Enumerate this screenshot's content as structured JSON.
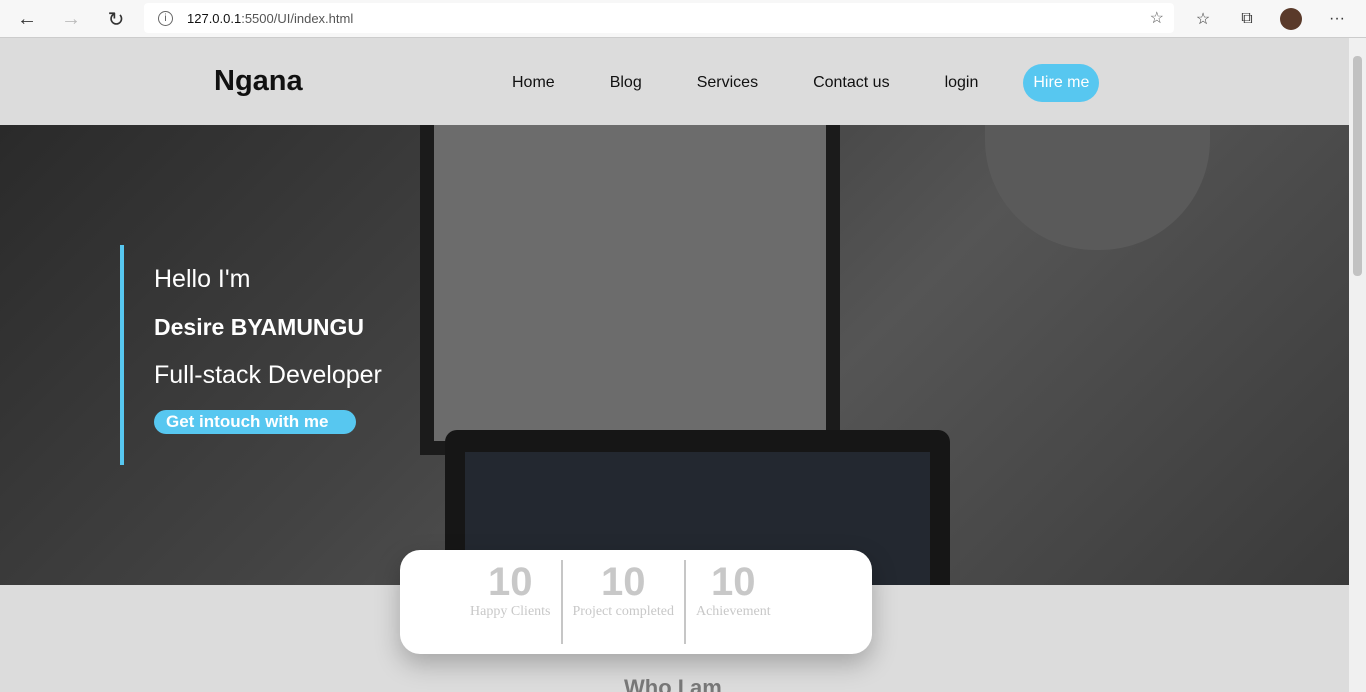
{
  "browser": {
    "url_host": "127.0.0.1",
    "url_rest": ":5500/UI/index.html"
  },
  "header": {
    "logo": "Ngana",
    "nav": [
      "Home",
      "Blog",
      "Services",
      "Contact us",
      "login"
    ],
    "hire": "Hire me"
  },
  "hero": {
    "greeting": "Hello I'm",
    "name": "Desire BYAMUNGU",
    "role": "Full-stack Developer",
    "cta": "Get intouch with me"
  },
  "stats": [
    {
      "value": "10",
      "label": "Happy Clients"
    },
    {
      "value": "10",
      "label": "Project completed"
    },
    {
      "value": "10",
      "label": "Achievement"
    }
  ],
  "section_title": "Who I am",
  "colors": {
    "accent": "#57c7f0"
  }
}
